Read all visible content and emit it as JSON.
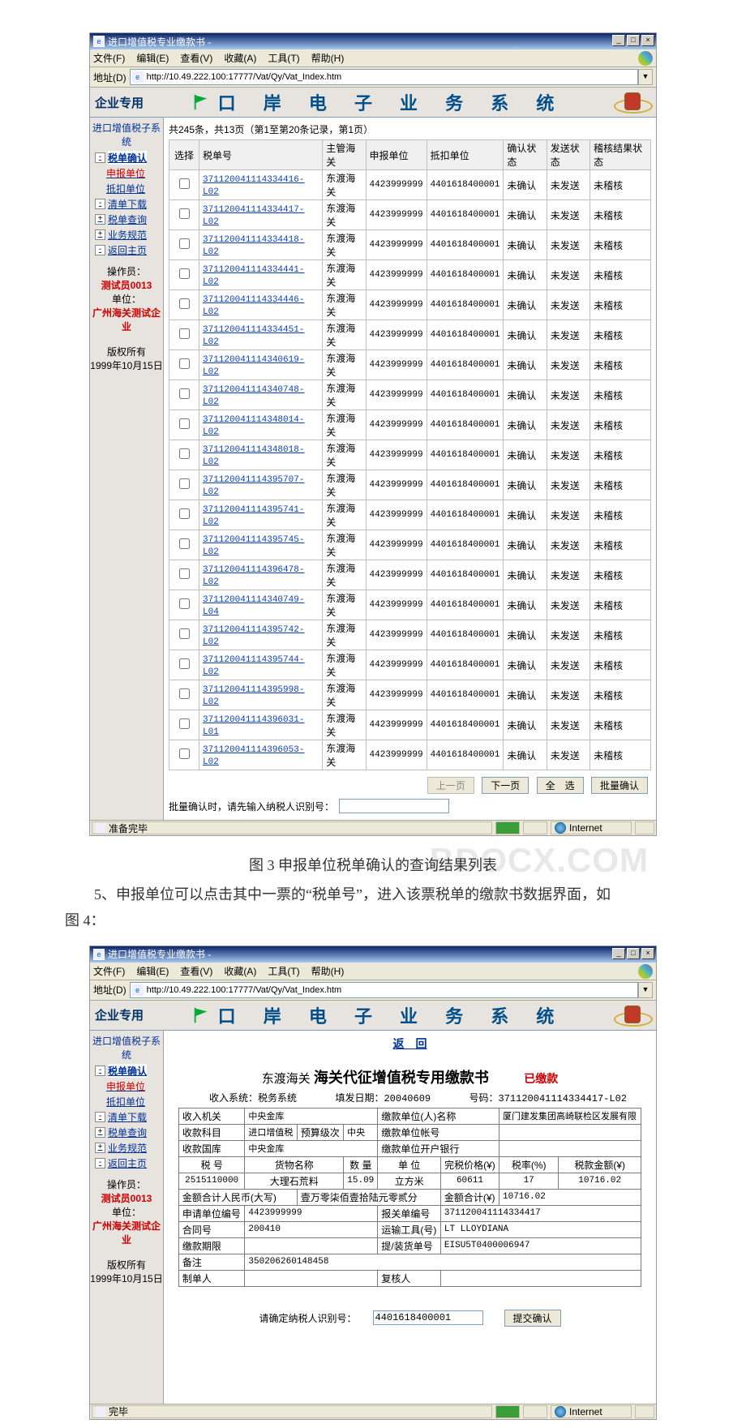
{
  "window1": {
    "title": "进口增值税专业缴款书 -",
    "menu": {
      "file": "文件(F)",
      "edit": "编辑(E)",
      "view": "查看(V)",
      "fav": "收藏(A)",
      "tools": "工具(T)",
      "help": "帮助(H)"
    },
    "addr_label": "地址(D)",
    "url": "http://10.49.222.100:17777/Vat/Qy/Vat_Index.htm",
    "brand": {
      "qiye": "企业专用",
      "oce": "口 岸 电 子 业 务 系 统"
    },
    "sidebar": {
      "sys": "进口增值税子系统",
      "items": [
        {
          "exp": "-",
          "label": "税单确认",
          "active": true
        },
        {
          "label": "申报单位",
          "cls": "red noexp"
        },
        {
          "label": "抵扣单位",
          "cls": "noexp"
        },
        {
          "exp": "-",
          "label": "清单下载"
        },
        {
          "exp": "+",
          "label": "税单查询"
        },
        {
          "exp": "+",
          "label": "业务规范"
        },
        {
          "exp": "-",
          "label": "返回主页"
        }
      ],
      "operator": {
        "l1": "操作员：",
        "l2": "测试员0013",
        "l3": "单位：",
        "l4": "广州海关测试企业"
      },
      "copyright1": "版权所有",
      "copyright2": "1999年10月15日"
    },
    "paging": "共245条，共13页（第1至第20条记录，第1页）",
    "buttons": {
      "prev": "上一页",
      "next": "下一页",
      "selall": "全　选",
      "batch": "批量确认"
    },
    "note_label": "批量确认时，请先输入纳税人识别号：",
    "table": {
      "headers": [
        "选择",
        "税单号",
        "主管海关",
        "申报单位",
        "抵扣单位",
        "确认状态",
        "发送状态",
        "稽核结果状态"
      ],
      "rows": [
        [
          "371120041114334416-L02",
          "东渡海关",
          "4423999999",
          "4401618400001",
          "未确认",
          "未发送",
          "未稽核"
        ],
        [
          "371120041114334417-L02",
          "东渡海关",
          "4423999999",
          "4401618400001",
          "未确认",
          "未发送",
          "未稽核"
        ],
        [
          "371120041114334418-L02",
          "东渡海关",
          "4423999999",
          "4401618400001",
          "未确认",
          "未发送",
          "未稽核"
        ],
        [
          "371120041114334441-L02",
          "东渡海关",
          "4423999999",
          "4401618400001",
          "未确认",
          "未发送",
          "未稽核"
        ],
        [
          "371120041114334446-L02",
          "东渡海关",
          "4423999999",
          "4401618400001",
          "未确认",
          "未发送",
          "未稽核"
        ],
        [
          "371120041114334451-L02",
          "东渡海关",
          "4423999999",
          "4401618400001",
          "未确认",
          "未发送",
          "未稽核"
        ],
        [
          "371120041114340619-L02",
          "东渡海关",
          "4423999999",
          "4401618400001",
          "未确认",
          "未发送",
          "未稽核"
        ],
        [
          "371120041114340748-L02",
          "东渡海关",
          "4423999999",
          "4401618400001",
          "未确认",
          "未发送",
          "未稽核"
        ],
        [
          "371120041114348014-L02",
          "东渡海关",
          "4423999999",
          "4401618400001",
          "未确认",
          "未发送",
          "未稽核"
        ],
        [
          "371120041114348018-L02",
          "东渡海关",
          "4423999999",
          "4401618400001",
          "未确认",
          "未发送",
          "未稽核"
        ],
        [
          "371120041114395707-L02",
          "东渡海关",
          "4423999999",
          "4401618400001",
          "未确认",
          "未发送",
          "未稽核"
        ],
        [
          "371120041114395741-L02",
          "东渡海关",
          "4423999999",
          "4401618400001",
          "未确认",
          "未发送",
          "未稽核"
        ],
        [
          "371120041114395745-L02",
          "东渡海关",
          "4423999999",
          "4401618400001",
          "未确认",
          "未发送",
          "未稽核"
        ],
        [
          "371120041114396478-L02",
          "东渡海关",
          "4423999999",
          "4401618400001",
          "未确认",
          "未发送",
          "未稽核"
        ],
        [
          "371120041114340749-L04",
          "东渡海关",
          "4423999999",
          "4401618400001",
          "未确认",
          "未发送",
          "未稽核"
        ],
        [
          "371120041114395742-L02",
          "东渡海关",
          "4423999999",
          "4401618400001",
          "未确认",
          "未发送",
          "未稽核"
        ],
        [
          "371120041114395744-L02",
          "东渡海关",
          "4423999999",
          "4401618400001",
          "未确认",
          "未发送",
          "未稽核"
        ],
        [
          "371120041114395998-L02",
          "东渡海关",
          "4423999999",
          "4401618400001",
          "未确认",
          "未发送",
          "未稽核"
        ],
        [
          "371120041114396031-L01",
          "东渡海关",
          "4423999999",
          "4401618400001",
          "未确认",
          "未发送",
          "未稽核"
        ],
        [
          "371120041114396053-L02",
          "东渡海关",
          "4423999999",
          "4401618400001",
          "未确认",
          "未发送",
          "未稽核"
        ]
      ]
    },
    "status": {
      "ready": "准备完毕",
      "zone": "Internet"
    }
  },
  "caption1": "图 3 申报单位税单确认的查询结果列表",
  "paragraph": {
    "line1": "5、申报单位可以点击其中一票的“税单号”，进入该票税单的缴款书数据界面，如",
    "line2": "图 4："
  },
  "watermark": "BDOCX.COM",
  "window2": {
    "title": "进口增值税专业缴款书 -",
    "return": "返　回",
    "bill": {
      "prefix": "东渡海关 ",
      "main": "海关代征增值税专用缴款书",
      "paid": "已缴款",
      "from_label": "收入系统：",
      "from": "税务系统",
      "date_label": "填发日期：",
      "date": "20040609",
      "no_label": "号码：",
      "no": "371120041114334417-L02",
      "labels": {
        "skjg": "收入机关",
        "skjg_v": "中央金库",
        "jkdw": "缴款单位(人)名称",
        "jkdw_v": "厦门建发集团高崎联检区发展有限",
        "skkm": "收款科目",
        "skkm_v": "进口增值税",
        "ysjc": "预算级次",
        "ysjc_v": "中央",
        "jkzh": "缴款单位帐号",
        "jkzh_v": "",
        "skgk": "收款国库",
        "skgk_v": "中央金库",
        "khyh": "缴款单位开户银行",
        "khyh_v": "",
        "sh": "税 号",
        "hwmc": "货物名称",
        "sl": "数 量",
        "dw": "单 位",
        "wsjg": "完税价格(¥)",
        "shuil": "税率(%)",
        "shuie": "税款金额(¥)",
        "sh_v": "2515110000",
        "hwmc_v": "大理石荒料",
        "sl_v": "15.09",
        "dw_v": "立方米",
        "wsjg_v": "60611",
        "shuil_v": "17",
        "shuie_v": "10716.02",
        "sumlab": "金额合计人民币(大写)",
        "sumtxt": "壹万零柒佰壹拾陆元零贰分",
        "sumhj": "金额合计(¥)",
        "sumhj_v": "10716.02",
        "sbdw": "申请单位编号",
        "sbdw_v": "4423999999",
        "bgbh": "报关单编号",
        "bgbh_v": "371120041114334417",
        "hth": "合同号",
        "hth_v": "200410",
        "ysgj": "运输工具(号)",
        "ysgj_v": "LT LLOYDIANA",
        "jkqx": "缴款期限",
        "jkqx_v": "",
        "tdh": "提/装货单号",
        "tdh_v": "EISU5T0400006947",
        "bz": "备注",
        "bz_v": "350206260148458",
        "zdr": "制单人",
        "fhr": "复核人"
      }
    },
    "confirm_label": "请确定纳税人识别号：",
    "confirm_value": "4401618400001",
    "confirm_btn": "提交确认",
    "status": {
      "ready": "完毕",
      "zone": "Internet"
    }
  }
}
